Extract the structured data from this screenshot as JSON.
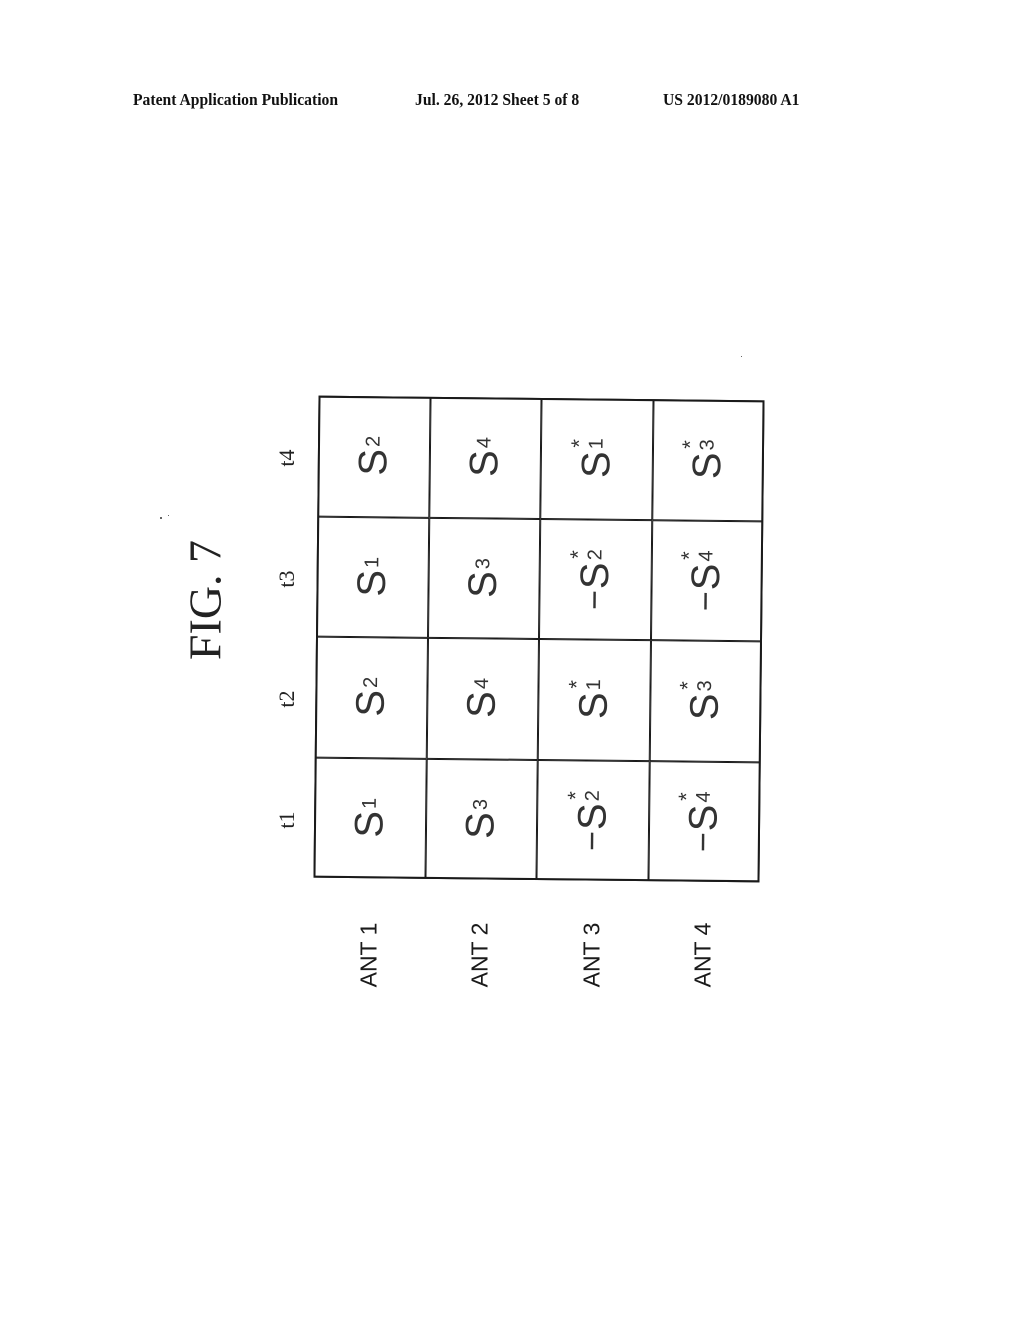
{
  "header": {
    "left": "Patent Application Publication",
    "middle": "Jul. 26, 2012   Sheet 5 of 8",
    "right": "US 2012/0189080 A1"
  },
  "figure": {
    "title": "FIG. 7",
    "time_labels": [
      "t1",
      "t2",
      "t3",
      "t4"
    ],
    "antenna_labels": [
      "ANT 1",
      "ANT 2",
      "ANT 3",
      "ANT 4"
    ],
    "matrix": [
      [
        {
          "neg": "",
          "base": "S",
          "conj": "",
          "sub": "1"
        },
        {
          "neg": "",
          "base": "S",
          "conj": "",
          "sub": "2"
        },
        {
          "neg": "",
          "base": "S",
          "conj": "",
          "sub": "1"
        },
        {
          "neg": "",
          "base": "S",
          "conj": "",
          "sub": "2"
        }
      ],
      [
        {
          "neg": "",
          "base": "S",
          "conj": "",
          "sub": "3"
        },
        {
          "neg": "",
          "base": "S",
          "conj": "",
          "sub": "4"
        },
        {
          "neg": "",
          "base": "S",
          "conj": "",
          "sub": "3"
        },
        {
          "neg": "",
          "base": "S",
          "conj": "",
          "sub": "4"
        }
      ],
      [
        {
          "neg": "−",
          "base": "S",
          "conj": "*",
          "sub": "2"
        },
        {
          "neg": "",
          "base": "S",
          "conj": "*",
          "sub": "1"
        },
        {
          "neg": "−",
          "base": "S",
          "conj": "*",
          "sub": "2"
        },
        {
          "neg": "",
          "base": "S",
          "conj": "*",
          "sub": "1"
        }
      ],
      [
        {
          "neg": "−",
          "base": "S",
          "conj": "*",
          "sub": "4"
        },
        {
          "neg": "",
          "base": "S",
          "conj": "*",
          "sub": "3"
        },
        {
          "neg": "−",
          "base": "S",
          "conj": "*",
          "sub": "4"
        },
        {
          "neg": "",
          "base": "S",
          "conj": "*",
          "sub": "3"
        }
      ]
    ]
  }
}
